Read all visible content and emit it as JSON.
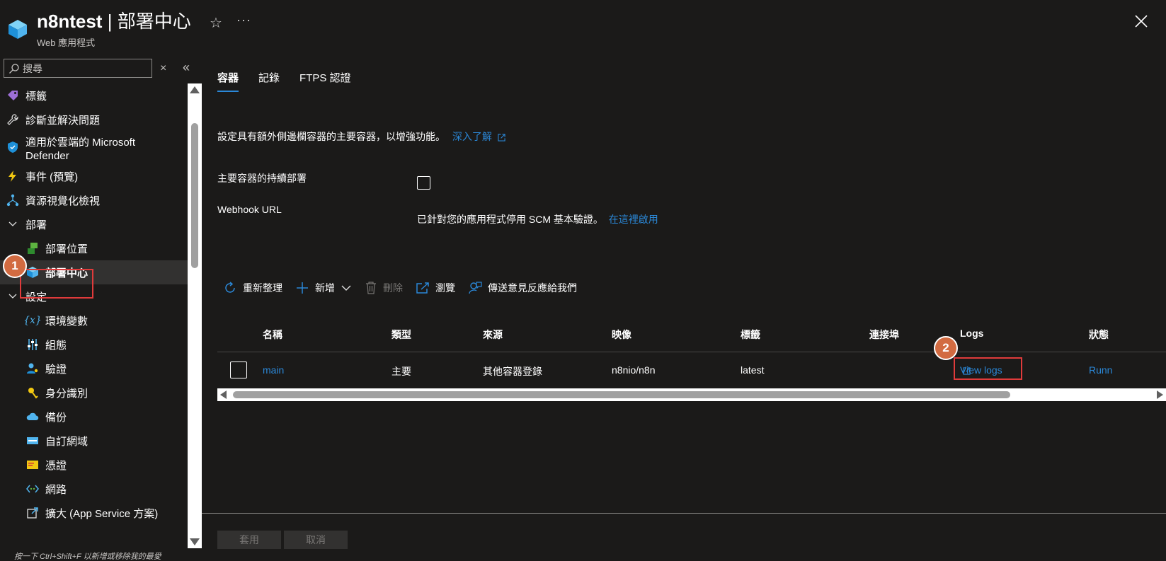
{
  "header": {
    "resource_name": "n8ntest",
    "separator": "|",
    "page_title": "部署中心",
    "subtitle": "Web 應用程式",
    "more": "···"
  },
  "sidebar": {
    "search_placeholder": "搜尋",
    "clear": "×",
    "collapse": "«",
    "items": [
      {
        "label": "標籤",
        "icon": "tag-icon"
      },
      {
        "label": "診斷並解決問題",
        "icon": "wrench-icon"
      },
      {
        "label": "適用於雲端的 Microsoft Defender",
        "icon": "shield-icon"
      },
      {
        "label": "事件 (預覽)",
        "icon": "lightning-icon"
      },
      {
        "label": "資源視覺化檢視",
        "icon": "hierarchy-icon"
      },
      {
        "label": "部署",
        "icon": "chevron-down-icon"
      },
      {
        "label": "部署位置",
        "icon": "slots-icon"
      },
      {
        "label": "部署中心",
        "icon": "cube-icon"
      },
      {
        "label": "設定",
        "icon": "chevron-down-icon"
      },
      {
        "label": "環境變數",
        "icon": "variable-icon"
      },
      {
        "label": "組態",
        "icon": "sliders-icon"
      },
      {
        "label": "驗證",
        "icon": "user-key-icon"
      },
      {
        "label": "身分識別",
        "icon": "key-icon"
      },
      {
        "label": "備份",
        "icon": "cloud-backup-icon"
      },
      {
        "label": "自訂網域",
        "icon": "domain-icon"
      },
      {
        "label": "憑證",
        "icon": "certificate-icon"
      },
      {
        "label": "網路",
        "icon": "network-icon"
      },
      {
        "label": "擴大 (App Service 方案)",
        "icon": "scale-up-icon"
      }
    ],
    "status_hint": "按一下 Ctrl+Shift+F 以新增或移除我的最愛"
  },
  "badges": {
    "one": "1",
    "two": "2"
  },
  "tabs": [
    "容器",
    "記錄",
    "FTPS 認證"
  ],
  "description": {
    "text": "設定具有額外側邊欄容器的主要容器，以增強功能。",
    "link": "深入了解"
  },
  "form": {
    "cd_label": "主要容器的持續部署",
    "webhook_label": "Webhook URL",
    "webhook_text": "已針對您的應用程式停用 SCM 基本驗證。",
    "webhook_link": "在這裡啟用"
  },
  "toolbar": {
    "refresh": "重新整理",
    "add": "新增",
    "delete": "刪除",
    "browse": "瀏覽",
    "feedback": "傳送意見反應給我們"
  },
  "grid": {
    "columns": [
      "名稱",
      "類型",
      "來源",
      "映像",
      "標籤",
      "連接埠",
      "Logs",
      "狀態"
    ],
    "rows": [
      {
        "name": "main",
        "type": "主要",
        "source": "其他容器登錄",
        "image": "n8nio/n8n",
        "tag": "latest",
        "port": "",
        "logs": "View logs",
        "status": "Runn"
      }
    ]
  },
  "footer": {
    "apply": "套用",
    "cancel": "取消"
  },
  "colors": {
    "accent": "#2b88d8",
    "badge": "#d26b41",
    "highlight": "#e03b3b",
    "background": "#1b1a19"
  }
}
